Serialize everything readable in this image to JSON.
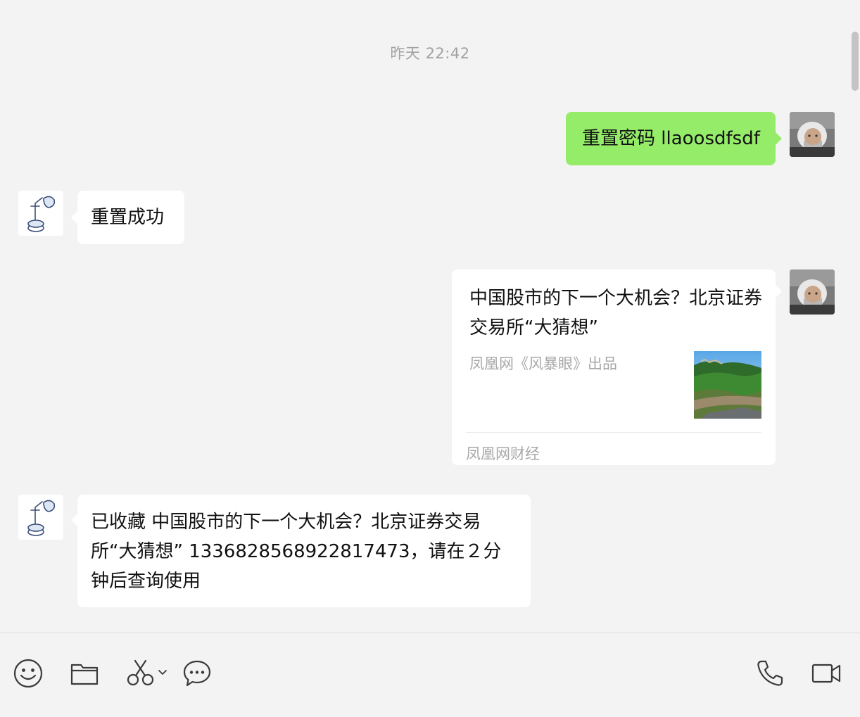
{
  "chat": {
    "timestamp": "昨天 22:42",
    "messages": [
      {
        "id": "m1",
        "sender": "me",
        "text": "重置密码 llaoosdfsdf"
      },
      {
        "id": "m2",
        "sender": "bot",
        "text": "重置成功"
      },
      {
        "id": "m3",
        "sender": "me",
        "type": "link-card",
        "title": "中国股市的下一个大机会？北京证券交易所“大猜想”",
        "description": "凤凰网《风暴眼》出品",
        "source": "凤凰网财经"
      },
      {
        "id": "m4",
        "sender": "bot",
        "text": "已收藏 中国股市的下一个大机会？北京证券交易所“大猜想” 1336828568922817473，请在２分钟后查询使用"
      }
    ]
  },
  "toolbar": {
    "left_icons": [
      "emoji-icon",
      "folder-icon",
      "scissors-icon",
      "chat-bubble-icon"
    ],
    "right_icons": [
      "phone-icon",
      "video-camera-icon"
    ]
  },
  "colors": {
    "background": "#f3f3f3",
    "bubble_self": "#95ec69",
    "bubble_other": "#ffffff",
    "muted_text": "#a8a8a8"
  }
}
